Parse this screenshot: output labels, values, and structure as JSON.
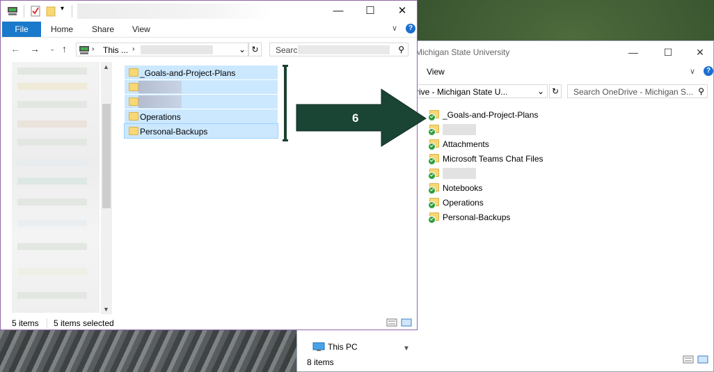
{
  "right_window": {
    "title": "Michigan State University",
    "ribbon_tab": "View",
    "address": "rive - Michigan State U...",
    "search_placeholder": "Search OneDrive - Michigan S...",
    "items": [
      {
        "label": "_Goals-and-Project-Plans",
        "blurred": false
      },
      {
        "label": "",
        "blurred": true
      },
      {
        "label": "Attachments",
        "blurred": false
      },
      {
        "label": "Microsoft Teams Chat Files",
        "blurred": false
      },
      {
        "label": "",
        "blurred": true
      },
      {
        "label": "Notebooks",
        "blurred": false
      },
      {
        "label": "Operations",
        "blurred": false
      },
      {
        "label": "Personal-Backups",
        "blurred": false
      }
    ],
    "nav_this_pc": "This PC",
    "status": "8 items"
  },
  "left_window": {
    "ribbon": {
      "file": "File",
      "home": "Home",
      "share": "Share",
      "view": "View"
    },
    "address": "This ...",
    "search_placeholder": "Search",
    "items": [
      {
        "label": "_Goals-and-Project-Plans",
        "blurred": false
      },
      {
        "label": "",
        "blurred": true
      },
      {
        "label": "",
        "blurred": true
      },
      {
        "label": "Operations",
        "blurred": false
      },
      {
        "label": "Personal-Backups",
        "blurred": false
      }
    ],
    "status_items": "5 items",
    "status_selected": "5 items selected"
  },
  "annotation": {
    "step_number": "6",
    "arrow_color": "#1a4434"
  },
  "colors": {
    "accent_blue": "#1979ca",
    "selection": "#cce8ff",
    "sync_check": "#2e9f3a"
  }
}
